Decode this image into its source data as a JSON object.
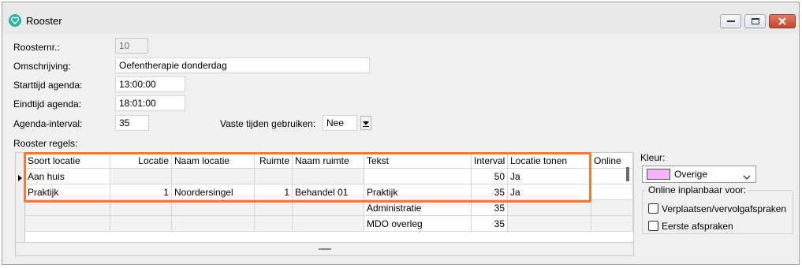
{
  "window": {
    "title": "Rooster",
    "colors": {
      "highlight": "#f07a34",
      "kleur_swatch": "#f3b3f7",
      "app_icon": "#2bb39b"
    }
  },
  "form": {
    "roosternr_label": "Roosternr.:",
    "roosternr_value": "10",
    "omschrijving_label": "Omschrijving:",
    "omschrijving_value": "Oefentherapie donderdag",
    "starttijd_label": "Starttijd agenda:",
    "starttijd_value": "13:00:00",
    "eindtijd_label": "Eindtijd agenda:",
    "eindtijd_value": "18:01:00",
    "interval_label": "Agenda-interval:",
    "interval_value": "35",
    "vaste_tijden_label": "Vaste tijden gebruiken:",
    "vaste_tijden_value": "Nee",
    "rooster_regels_label": "Rooster regels:"
  },
  "table": {
    "columns": [
      "Soort locatie",
      "Locatie",
      "Naam locatie",
      "Ruimte",
      "Naam ruimte",
      "Tekst",
      "Interval",
      "Locatie tonen",
      "Online"
    ],
    "rows": [
      [
        "Aan huis",
        "",
        "",
        "",
        "",
        "",
        "50",
        "Ja",
        ""
      ],
      [
        "Praktijk",
        "1",
        "Noordersingel",
        "1",
        "Behandel 01",
        "Praktijk",
        "35",
        "Ja",
        ""
      ],
      [
        "",
        "",
        "",
        "",
        "",
        "Administratie",
        "35",
        "",
        ""
      ],
      [
        "",
        "",
        "",
        "",
        "",
        "MDO overleg",
        "35",
        "",
        ""
      ]
    ]
  },
  "side": {
    "kleur_label": "Kleur:",
    "kleur_value": "Overige",
    "online_group_title": "Online inplanbaar voor:",
    "checkbox_1_label": "Verplaatsen/vervolgafspraken",
    "checkbox_1_checked": false,
    "checkbox_2_label": "Eerste afspraken",
    "checkbox_2_checked": false
  }
}
